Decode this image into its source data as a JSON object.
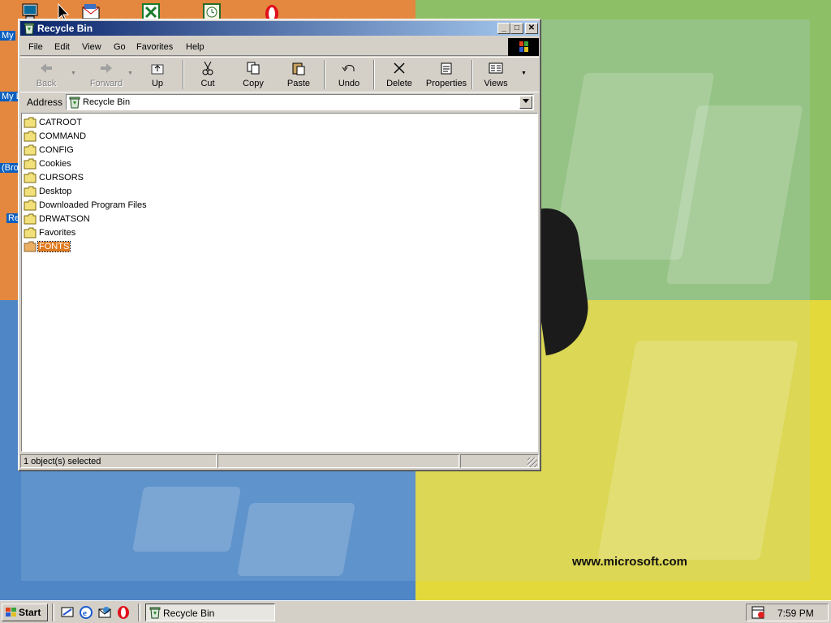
{
  "window": {
    "title": "Recycle Bin",
    "menu": [
      "File",
      "Edit",
      "View",
      "Go",
      "Favorites",
      "Help"
    ],
    "toolbar": {
      "back": "Back",
      "forward": "Forward",
      "up": "Up",
      "cut": "Cut",
      "copy": "Copy",
      "paste": "Paste",
      "undo": "Undo",
      "delete": "Delete",
      "properties": "Properties",
      "views": "Views"
    },
    "address": {
      "label": "Address",
      "value": "Recycle Bin"
    },
    "files": [
      "CATROOT",
      "COMMAND",
      "CONFIG",
      "Cookies",
      "CURSORS",
      "Desktop",
      "Downloaded Program Files",
      "DRWATSON",
      "Favorites",
      "FONTS"
    ],
    "selected_file": "FONTS",
    "status": "1 object(s) selected"
  },
  "desktop": {
    "labels": [
      "My",
      "My D",
      "(Bro",
      "Re"
    ],
    "url": "www.microsoft.com"
  },
  "taskbar": {
    "start": "Start",
    "task": "Recycle Bin",
    "clock": "7:59 PM"
  },
  "colors": {
    "titlebar": "#0a246a",
    "selection": "#e07a20"
  }
}
